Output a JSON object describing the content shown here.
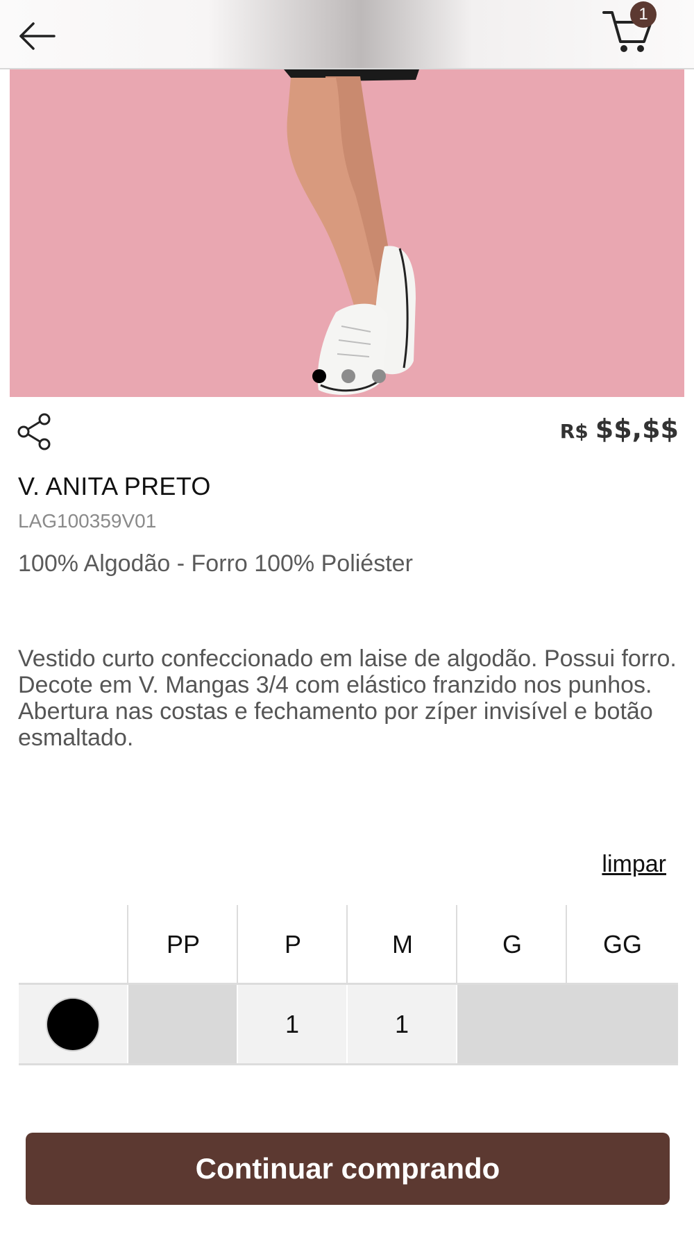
{
  "header": {
    "back_icon": "arrow-left-icon",
    "cart_icon": "shopping-cart-icon",
    "cart_count": "1",
    "badge_color": "#5c3931"
  },
  "gallery": {
    "background_color": "#e9a6b0",
    "current_index": 0,
    "dots": [
      {
        "active": true,
        "color": "#000000"
      },
      {
        "active": false,
        "color": "#8c8c8c"
      },
      {
        "active": false,
        "color": "#8c8c8c"
      }
    ]
  },
  "product": {
    "share_icon": "share-icon",
    "currency": "R$",
    "price": "$$,$$",
    "name": "V. ANITA PRETO",
    "sku": "LAG100359V01",
    "composition": "100% Algodão - Forro 100% Poliéster",
    "description": "Vestido curto confeccionado em laise de algodão. Possui forro. Decote em V. Mangas 3/4 com elástico franzido nos punhos. Abertura nas costas e fechamento por zíper invisível e botão esmaltado."
  },
  "size_selector": {
    "clear_label": "limpar",
    "sizes": [
      "PP",
      "P",
      "M",
      "G",
      "GG"
    ],
    "colors": [
      {
        "swatch_color": "#000000",
        "quantities": [
          "",
          "1",
          "1",
          "",
          ""
        ],
        "available": [
          false,
          true,
          true,
          false,
          false
        ]
      }
    ]
  },
  "footer": {
    "continue_label": "Continuar comprando",
    "button_color": "#5c3931"
  }
}
